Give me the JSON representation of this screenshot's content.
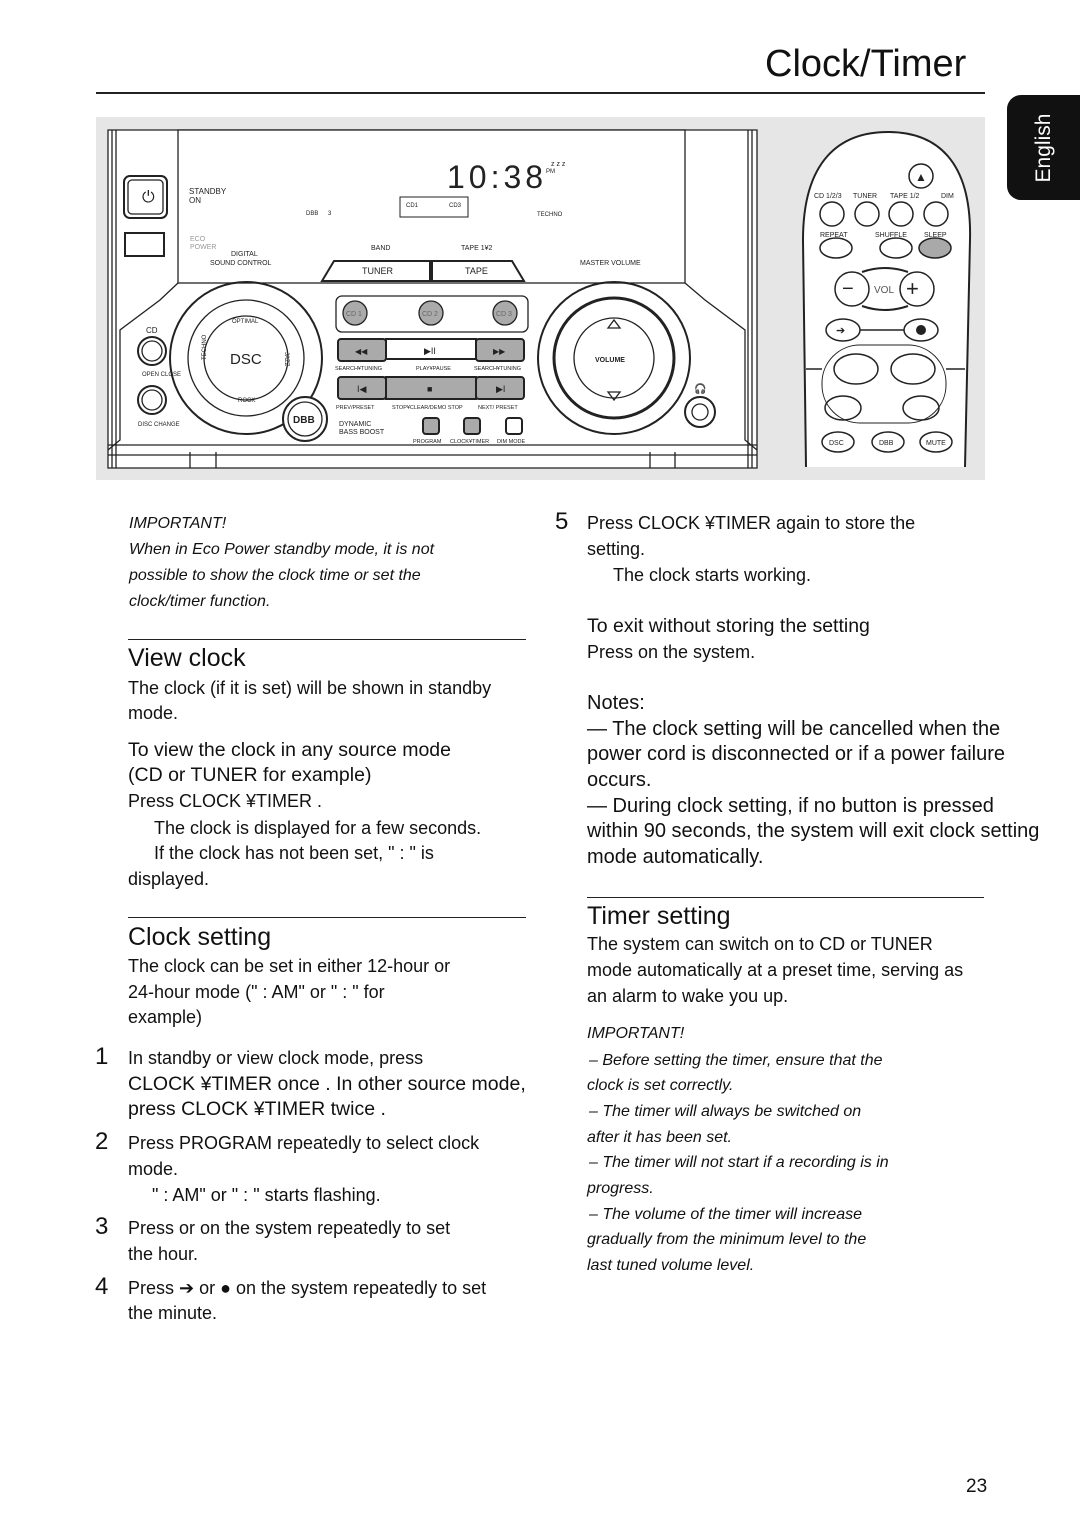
{
  "header": {
    "title": "Clock/Timer",
    "language_tab": "English"
  },
  "device": {
    "standby": "STANDBY",
    "on": "ON",
    "eco": "ECO",
    "power": "POWER",
    "digital": "DIGITAL",
    "sound_control": "SOUND CONTROL",
    "clock_display": "10:38",
    "pm": "PM",
    "zzz": "z z z",
    "dbb_indicator": "DBB",
    "display_3": "3",
    "cd1": "CD1",
    "cd3": "CD3",
    "techno_indicator": "TECHNO",
    "band": "BAND",
    "tape12": "TAPE 1¥2",
    "tuner": "TUNER",
    "tape": "TAPE",
    "master_volume": "MASTER VOLUME",
    "cd_buttons": [
      "CD 1",
      "CD 2",
      "CD 3"
    ],
    "cd": "CD",
    "open_close": "OPEN CLOSE",
    "disc_change": "DISC CHANGE",
    "dsc": "DSC",
    "optimal": "OPTIMAL",
    "techno": "TECHNO",
    "jazz": "JAZZ",
    "rock": "ROCK",
    "search_tuning": "SEARCH¥TUNING",
    "play_pause": "PLAY¥PAUSE",
    "prev_preset": "PREV/PRESET",
    "stop_clear": "STOP¥CLEAR/DEMO STOP",
    "next_preset": "NEXT/ PRESET",
    "dbb": "DBB",
    "dynamic": "DYNAMIC",
    "bass_boost": "BASS BOOST",
    "program": "PROGRAM",
    "clock_timer": "CLOCK¥TIMER",
    "dim_mode": "DIM MODE",
    "volume": "VOLUME"
  },
  "remote": {
    "row1": [
      "CD 1/2/3",
      "TUNER",
      "TAPE 1/2",
      "DIM"
    ],
    "row2": [
      "REPEAT",
      "SHUFFLE",
      "SLEEP"
    ],
    "vol": "VOL",
    "row_bottom": [
      "DSC",
      "DBB",
      "MUTE"
    ],
    "sleep_color": "#a9a9a9"
  },
  "left": {
    "important_title": "IMPORTANT!",
    "important_lines": [
      "When in Eco Power standby mode, it is not",
      "possible to show the clock time or set the",
      "clock/timer function."
    ],
    "view_clock": {
      "heading": "View clock",
      "intro": [
        "The clock (if it is set) will be shown in standby",
        "mode."
      ],
      "sub": [
        "To view the clock in any source mode",
        "(CD or TUNER for example)"
      ],
      "press": "Press CLOCK ¥TIMER .",
      "result": [
        "The clock is displayed for a few seconds.",
        "If the clock has not been set, \"   :     \" is",
        "displayed."
      ]
    },
    "clock_setting": {
      "heading": "Clock setting",
      "intro": [
        "The clock can be set in either 12-hour or",
        "24-hour mode (\"   :      AM\" or \"   :     \" for",
        "example)"
      ],
      "steps": [
        {
          "n": "1",
          "lines": [
            "In standby or view clock mode, press",
            "CLOCK ¥TIMER once .  In other source mode,",
            "press CLOCK ¥TIMER twice ."
          ]
        },
        {
          "n": "2",
          "lines": [
            "Press PROGRAM repeatedly to select clock",
            "mode."
          ],
          "result": "\"   :      AM\" or \"   :     \" starts flashing."
        },
        {
          "n": "3",
          "lines": [
            "Press      or      on the system repeatedly to set",
            "the hour."
          ]
        },
        {
          "n": "4",
          "lines": [
            "Press ➔  or ●  on the system repeatedly to set",
            "the minute."
          ]
        }
      ]
    }
  },
  "right": {
    "step5": {
      "n": "5",
      "lines": [
        "Press CLOCK ¥TIMER again to store the",
        "setting."
      ],
      "result": "The clock starts working."
    },
    "exit": {
      "heading": "To exit without storing the setting",
      "text": "Press     on the system."
    },
    "notes": {
      "title": "Notes:",
      "lines": [
        "—  The clock setting will be cancelled when the",
        "power cord is disconnected or if a power failure",
        "occurs.",
        "—  During clock setting, if no button is pressed",
        "within 90 seconds, the system will exit clock setting",
        "mode automatically."
      ]
    },
    "timer_setting": {
      "heading": "Timer setting",
      "intro": [
        "The system can switch on to CD or TUNER",
        "mode automatically at a preset time, serving as",
        "an alarm to wake you up."
      ],
      "important_title": "IMPORTANT!",
      "important_lines": [
        "–  Before setting the timer, ensure that the",
        "clock is set correctly.",
        "–  The timer will always be switched on",
        "after it has been set.",
        "–  The timer will not start if a recording is in",
        "progress.",
        "–  The volume of the timer will increase",
        "gradually from the minimum level to the",
        "last tuned volume level."
      ]
    }
  },
  "footer": {
    "page_number": "23"
  }
}
